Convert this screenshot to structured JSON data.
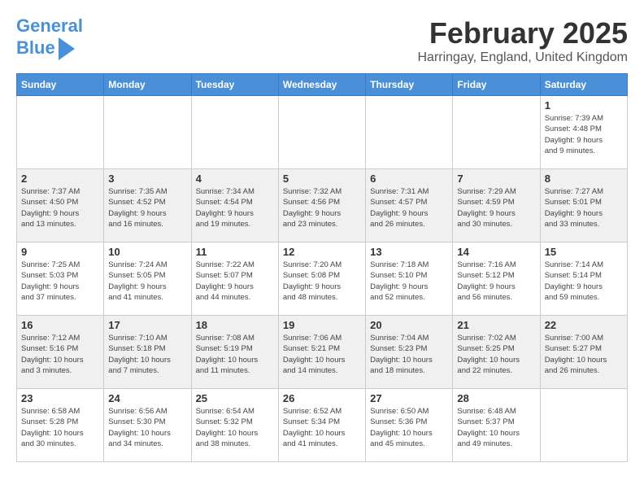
{
  "header": {
    "logo_line1": "General",
    "logo_line2": "Blue",
    "title": "February 2025",
    "subtitle": "Harringay, England, United Kingdom"
  },
  "weekdays": [
    "Sunday",
    "Monday",
    "Tuesday",
    "Wednesday",
    "Thursday",
    "Friday",
    "Saturday"
  ],
  "weeks": [
    [
      {
        "day": "",
        "info": ""
      },
      {
        "day": "",
        "info": ""
      },
      {
        "day": "",
        "info": ""
      },
      {
        "day": "",
        "info": ""
      },
      {
        "day": "",
        "info": ""
      },
      {
        "day": "",
        "info": ""
      },
      {
        "day": "1",
        "info": "Sunrise: 7:39 AM\nSunset: 4:48 PM\nDaylight: 9 hours\nand 9 minutes."
      }
    ],
    [
      {
        "day": "2",
        "info": "Sunrise: 7:37 AM\nSunset: 4:50 PM\nDaylight: 9 hours\nand 13 minutes."
      },
      {
        "day": "3",
        "info": "Sunrise: 7:35 AM\nSunset: 4:52 PM\nDaylight: 9 hours\nand 16 minutes."
      },
      {
        "day": "4",
        "info": "Sunrise: 7:34 AM\nSunset: 4:54 PM\nDaylight: 9 hours\nand 19 minutes."
      },
      {
        "day": "5",
        "info": "Sunrise: 7:32 AM\nSunset: 4:56 PM\nDaylight: 9 hours\nand 23 minutes."
      },
      {
        "day": "6",
        "info": "Sunrise: 7:31 AM\nSunset: 4:57 PM\nDaylight: 9 hours\nand 26 minutes."
      },
      {
        "day": "7",
        "info": "Sunrise: 7:29 AM\nSunset: 4:59 PM\nDaylight: 9 hours\nand 30 minutes."
      },
      {
        "day": "8",
        "info": "Sunrise: 7:27 AM\nSunset: 5:01 PM\nDaylight: 9 hours\nand 33 minutes."
      }
    ],
    [
      {
        "day": "9",
        "info": "Sunrise: 7:25 AM\nSunset: 5:03 PM\nDaylight: 9 hours\nand 37 minutes."
      },
      {
        "day": "10",
        "info": "Sunrise: 7:24 AM\nSunset: 5:05 PM\nDaylight: 9 hours\nand 41 minutes."
      },
      {
        "day": "11",
        "info": "Sunrise: 7:22 AM\nSunset: 5:07 PM\nDaylight: 9 hours\nand 44 minutes."
      },
      {
        "day": "12",
        "info": "Sunrise: 7:20 AM\nSunset: 5:08 PM\nDaylight: 9 hours\nand 48 minutes."
      },
      {
        "day": "13",
        "info": "Sunrise: 7:18 AM\nSunset: 5:10 PM\nDaylight: 9 hours\nand 52 minutes."
      },
      {
        "day": "14",
        "info": "Sunrise: 7:16 AM\nSunset: 5:12 PM\nDaylight: 9 hours\nand 56 minutes."
      },
      {
        "day": "15",
        "info": "Sunrise: 7:14 AM\nSunset: 5:14 PM\nDaylight: 9 hours\nand 59 minutes."
      }
    ],
    [
      {
        "day": "16",
        "info": "Sunrise: 7:12 AM\nSunset: 5:16 PM\nDaylight: 10 hours\nand 3 minutes."
      },
      {
        "day": "17",
        "info": "Sunrise: 7:10 AM\nSunset: 5:18 PM\nDaylight: 10 hours\nand 7 minutes."
      },
      {
        "day": "18",
        "info": "Sunrise: 7:08 AM\nSunset: 5:19 PM\nDaylight: 10 hours\nand 11 minutes."
      },
      {
        "day": "19",
        "info": "Sunrise: 7:06 AM\nSunset: 5:21 PM\nDaylight: 10 hours\nand 14 minutes."
      },
      {
        "day": "20",
        "info": "Sunrise: 7:04 AM\nSunset: 5:23 PM\nDaylight: 10 hours\nand 18 minutes."
      },
      {
        "day": "21",
        "info": "Sunrise: 7:02 AM\nSunset: 5:25 PM\nDaylight: 10 hours\nand 22 minutes."
      },
      {
        "day": "22",
        "info": "Sunrise: 7:00 AM\nSunset: 5:27 PM\nDaylight: 10 hours\nand 26 minutes."
      }
    ],
    [
      {
        "day": "23",
        "info": "Sunrise: 6:58 AM\nSunset: 5:28 PM\nDaylight: 10 hours\nand 30 minutes."
      },
      {
        "day": "24",
        "info": "Sunrise: 6:56 AM\nSunset: 5:30 PM\nDaylight: 10 hours\nand 34 minutes."
      },
      {
        "day": "25",
        "info": "Sunrise: 6:54 AM\nSunset: 5:32 PM\nDaylight: 10 hours\nand 38 minutes."
      },
      {
        "day": "26",
        "info": "Sunrise: 6:52 AM\nSunset: 5:34 PM\nDaylight: 10 hours\nand 41 minutes."
      },
      {
        "day": "27",
        "info": "Sunrise: 6:50 AM\nSunset: 5:36 PM\nDaylight: 10 hours\nand 45 minutes."
      },
      {
        "day": "28",
        "info": "Sunrise: 6:48 AM\nSunset: 5:37 PM\nDaylight: 10 hours\nand 49 minutes."
      },
      {
        "day": "",
        "info": ""
      }
    ]
  ],
  "gray_weeks": [
    1,
    3
  ]
}
